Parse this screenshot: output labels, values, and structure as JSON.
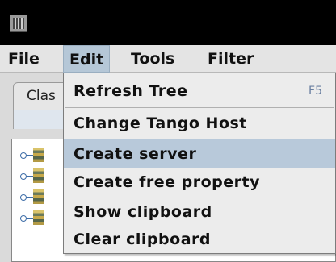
{
  "window": {
    "icon": "app-icon"
  },
  "menubar": {
    "items": [
      {
        "label": "File"
      },
      {
        "label": "Edit"
      },
      {
        "label": "Tools"
      },
      {
        "label": "Filter"
      }
    ]
  },
  "background": {
    "tab_label": "Clas",
    "tree_node_icon": "server-node-icon",
    "tree_nodes": 4
  },
  "edit_menu": {
    "items": [
      {
        "label": "Refresh Tree",
        "accelerator": "F5"
      },
      {
        "label": "Change Tango Host"
      },
      {
        "label": "Create server"
      },
      {
        "label": "Create free property"
      },
      {
        "label": "Show clipboard"
      },
      {
        "label": "Clear clipboard"
      }
    ],
    "highlighted_item": "Create server"
  },
  "colors": {
    "highlight": "#b8c9da",
    "accelerator": "#6a7fa0"
  }
}
